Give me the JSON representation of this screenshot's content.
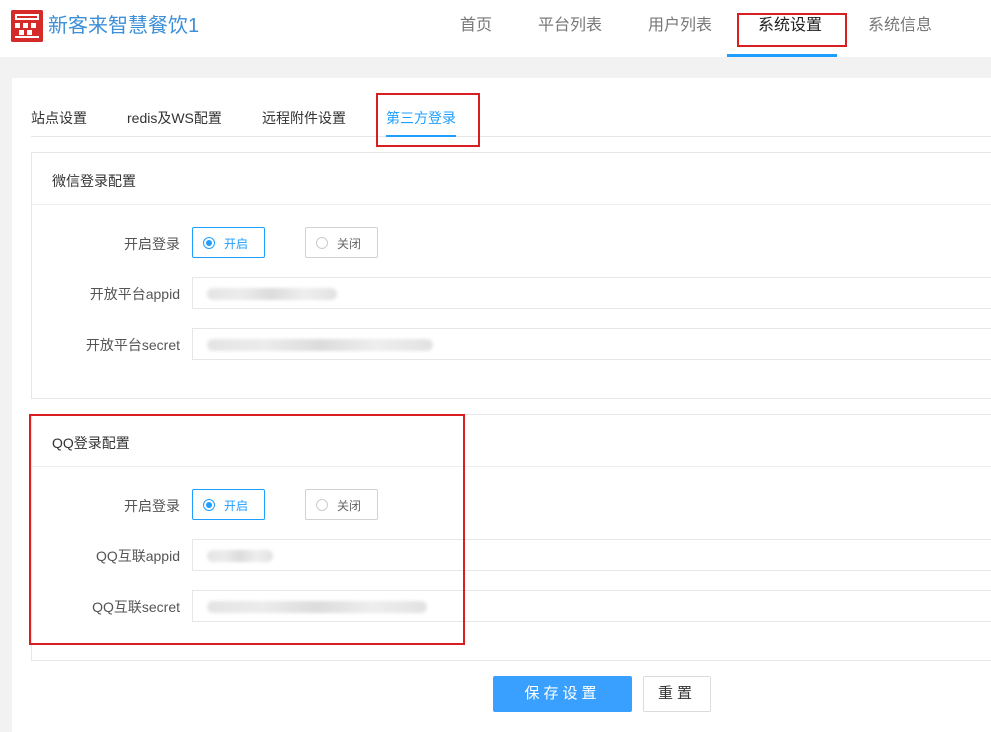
{
  "header": {
    "app_title": "新客来智慧餐饮1",
    "nav": [
      "首页",
      "平台列表",
      "用户列表",
      "系统设置",
      "系统信息"
    ]
  },
  "subtabs": [
    "站点设置",
    "redis及WS配置",
    "远程附件设置",
    "第三方登录"
  ],
  "wechat": {
    "title": "微信登录配置",
    "enable_label": "开启登录",
    "on": "开启",
    "off": "关闭",
    "appid_label": "开放平台appid",
    "secret_label": "开放平台secret"
  },
  "qq": {
    "title": "QQ登录配置",
    "enable_label": "开启登录",
    "on": "开启",
    "off": "关闭",
    "appid_label": "QQ互联appid",
    "secret_label": "QQ互联secret"
  },
  "buttons": {
    "save": "保存设置",
    "reset": "重置"
  },
  "colors": {
    "accent": "#1e9fff",
    "highlight": "#d81e1e",
    "logo": "#d42a2a"
  },
  "icons": {
    "logo": "app-logo-icon",
    "radio": "radio-icon"
  }
}
